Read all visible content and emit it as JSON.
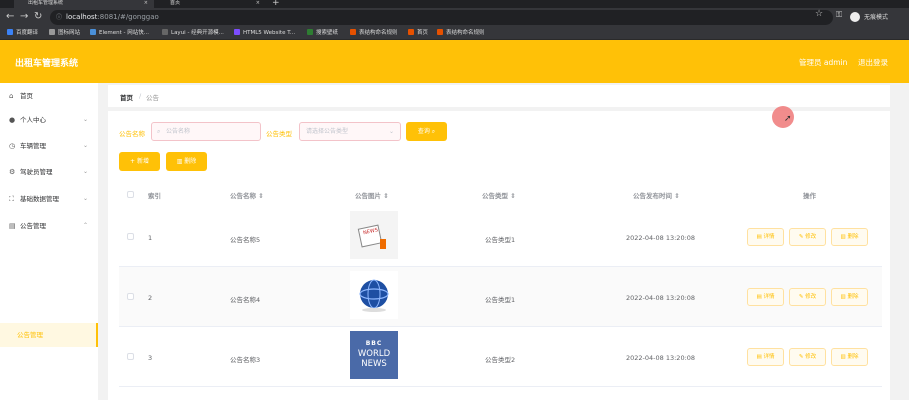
{
  "browser": {
    "tab_active": "出租车管理系统",
    "tab_second": "首页",
    "url_host": "localhost",
    "url_rest": ":8081/#/gonggao",
    "incognito": "无痕模式",
    "bookmarks": [
      "百度翻译",
      "图标网站",
      "Element - 网站快...",
      "Layui - 经典开源模...",
      "HTML5 Website T...",
      "搜索壁纸",
      "表结构命名规则",
      "首页",
      "表结构命名规则"
    ],
    "bookmark_colors": [
      "#3b82f6",
      "#999999",
      "#4a90d9",
      "#666666",
      "#7c4dff",
      "#2e7d32",
      "#e65100",
      "#e65100",
      "#e65100"
    ]
  },
  "header": {
    "title": "出租车管理系统",
    "user": "管理员 admin",
    "logout": "退出登录"
  },
  "sidebar": {
    "items": [
      {
        "label": "首页",
        "icon": "home-icon",
        "glyph": "⌂",
        "chevron": ""
      },
      {
        "label": "个人中心",
        "icon": "user-icon",
        "glyph": "●",
        "chevron": "⌄"
      },
      {
        "label": "车辆管理",
        "icon": "clock-icon",
        "glyph": "◷",
        "chevron": "⌄"
      },
      {
        "label": "驾驶员管理",
        "icon": "settings-icon",
        "glyph": "⚙",
        "chevron": "⌄"
      },
      {
        "label": "基础数据管理",
        "icon": "frame-icon",
        "glyph": "⛶",
        "chevron": "⌄"
      },
      {
        "label": "公告管理",
        "icon": "bank-icon",
        "glyph": "▤",
        "chevron": "⌃"
      }
    ],
    "sub_active": "公告管理"
  },
  "breadcrumb": {
    "home": "首页",
    "sep": "/",
    "current": "公告"
  },
  "search": {
    "name_label": "公告名称",
    "name_placeholder": "公告名称",
    "type_label": "公告类型",
    "type_placeholder": "请选择公告类型",
    "query_btn": "查询"
  },
  "actions": {
    "add": "新增",
    "delete": "删除"
  },
  "table": {
    "columns": [
      "索引",
      "公告名称",
      "公告图片",
      "公告类型",
      "公告发布时间",
      "操作"
    ],
    "rows": [
      {
        "index": "1",
        "name": "公告名称5",
        "type": "公告类型1",
        "time": "2022-04-08 13:20:08"
      },
      {
        "index": "2",
        "name": "公告名称4",
        "type": "公告类型1",
        "time": "2022-04-08 13:20:08"
      },
      {
        "index": "3",
        "name": "公告名称3",
        "type": "公告类型2",
        "time": "2022-04-08 13:20:08"
      }
    ],
    "ops": {
      "detail": "详情",
      "edit": "修改",
      "del": "删除"
    },
    "bbc_text": [
      "BBC",
      "WORLD",
      "NEWS"
    ]
  }
}
